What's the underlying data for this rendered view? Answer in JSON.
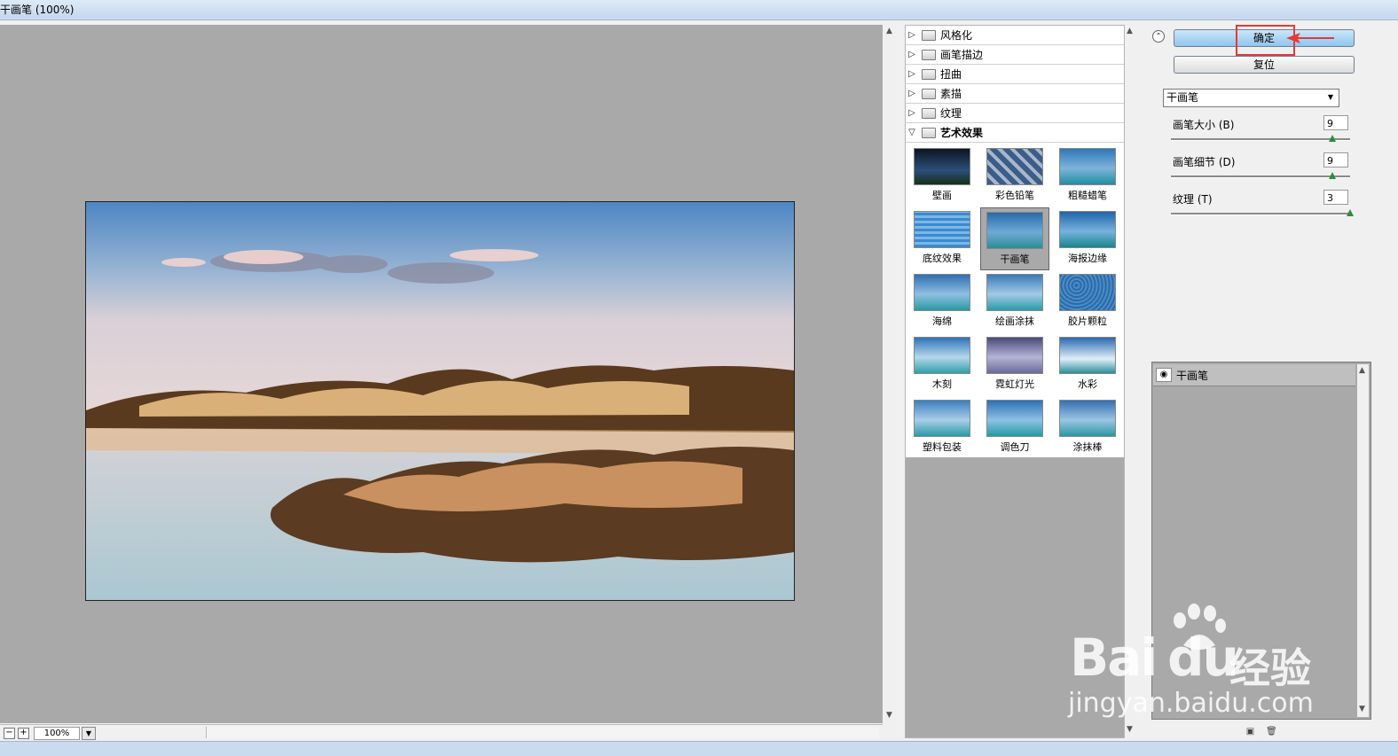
{
  "window": {
    "title": "干画笔 (100%)"
  },
  "preview": {
    "zoom": "100%"
  },
  "gallery": {
    "categories": [
      {
        "label": "风格化"
      },
      {
        "label": "画笔描边"
      },
      {
        "label": "扭曲"
      },
      {
        "label": "素描"
      },
      {
        "label": "纹理"
      },
      {
        "label": "艺术效果"
      }
    ],
    "thumbnails": [
      "壁画",
      "彩色铅笔",
      "粗糙蜡笔",
      "底纹效果",
      "干画笔",
      "海报边缘",
      "海绵",
      "绘画涂抹",
      "胶片颗粒",
      "木刻",
      "霓虹灯光",
      "水彩",
      "塑料包装",
      "调色刀",
      "涂抹棒"
    ],
    "selected": "干画笔"
  },
  "controls": {
    "ok_label": "确定",
    "reset_label": "复位",
    "filter_select": "干画笔",
    "params": [
      {
        "label": "画笔大小 (B)",
        "value": "9",
        "fraction": 0.9
      },
      {
        "label": "画笔细节 (D)",
        "value": "9",
        "fraction": 0.9
      },
      {
        "label": "纹理 (T)",
        "value": "3",
        "fraction": 1.0
      }
    ]
  },
  "layers": {
    "items": [
      {
        "label": "干画笔"
      }
    ]
  },
  "watermark": {
    "brand": "Bai",
    "brand2": "du",
    "cn": "经验",
    "url": "jingyan.baidu.com"
  },
  "colors": {
    "accent_button": "#8ec6ee",
    "highlight_box": "#e53935",
    "knob": "#2e8b3b"
  }
}
